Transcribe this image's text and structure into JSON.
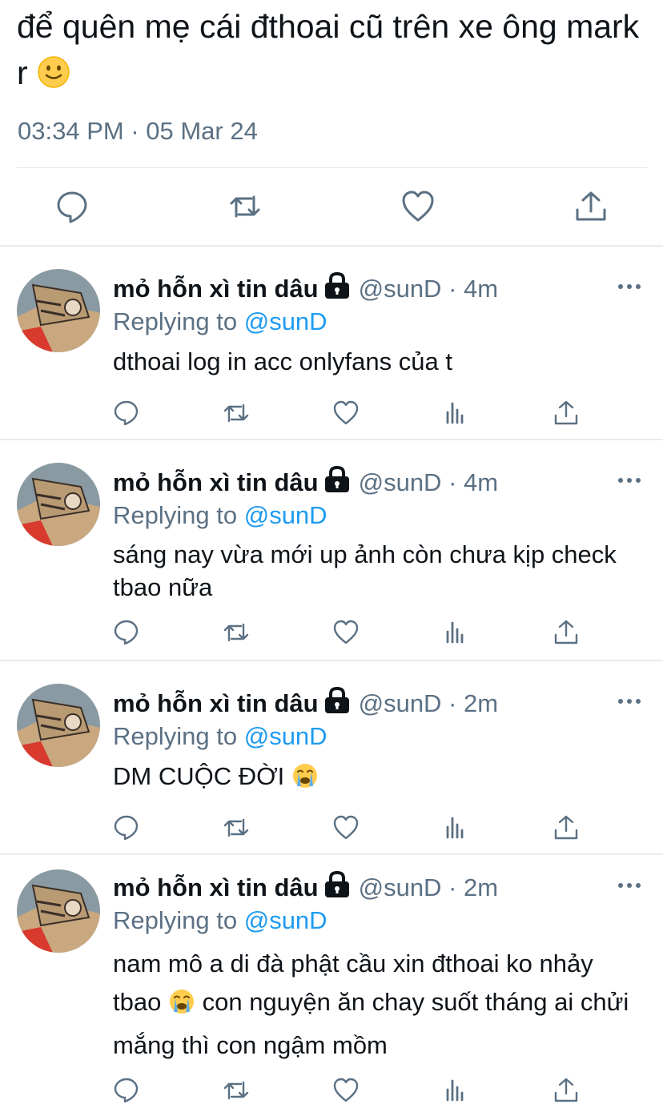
{
  "main_tweet": {
    "text": "để quên mẹ cái đthoai cũ trên xe ông mark r",
    "emoji": "slightly-smiling-face",
    "timestamp": "03:34 PM · 05 Mar 24",
    "actions": [
      "reply-icon",
      "retweet-icon",
      "like-icon",
      "share-icon"
    ]
  },
  "replies": [
    {
      "author": "mỏ hỗn xì tin dâu",
      "handle": "@sunD",
      "time": "4m",
      "replying_label": "Replying to",
      "replying_to": "@sunD",
      "text": "dthoai log in acc onlyfans của t"
    },
    {
      "author": "mỏ hỗn xì tin dâu",
      "handle": "@sunD",
      "time": "4m",
      "replying_label": "Replying to",
      "replying_to": "@sunD",
      "text": "sáng nay vừa mới up ảnh còn chưa kịp check tbao nữa"
    },
    {
      "author": "mỏ hỗn xì tin dâu",
      "handle": "@sunD",
      "time": "2m",
      "replying_label": "Replying to",
      "replying_to": "@sunD",
      "text": "DM CUỘC ĐỜI",
      "emoji": "loudly-crying-face"
    },
    {
      "author": "mỏ hỗn xì tin dâu",
      "handle": "@sunD",
      "time": "2m",
      "replying_label": "Replying to",
      "replying_to": "@sunD",
      "text_before_emoji": "nam mô a di đà phật cầu xin đthoai ko nhảy tbao",
      "emoji": "loudly-crying-face",
      "text_after_emoji": "con nguyện ăn chay suốt tháng ai chửi mắng thì con ngậm mồm"
    }
  ],
  "colors": {
    "text": "#0f1419",
    "secondary": "#5b7083",
    "link": "#1d9bf0",
    "divider": "#e6ecf0"
  }
}
